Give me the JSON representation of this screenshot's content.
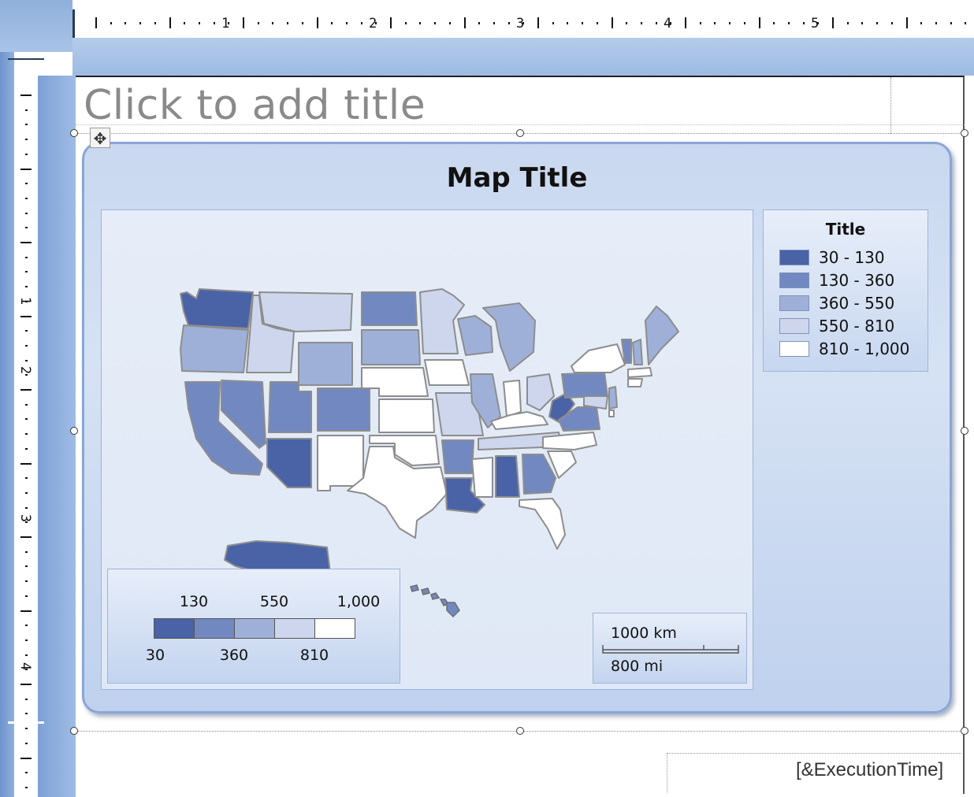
{
  "slide": {
    "title_placeholder": "Click to add title"
  },
  "ruler": {
    "horizontal_labels": [
      "1",
      "2",
      "3",
      "4",
      "5"
    ],
    "vertical_labels": [
      "1",
      "2",
      "3",
      "4"
    ]
  },
  "map": {
    "title": "Map Title",
    "legend": {
      "title": "Title",
      "items": [
        {
          "label": "30 - 130",
          "color": "#4a62a6"
        },
        {
          "label": "130 - 360",
          "color": "#7288c0"
        },
        {
          "label": "360 - 550",
          "color": "#9fb0d8"
        },
        {
          "label": "550 - 810",
          "color": "#cdd6ec"
        },
        {
          "label": "810 - 1,000",
          "color": "#ffffff"
        }
      ]
    },
    "color_scale": {
      "top_labels": [
        "130",
        "550",
        "1,000"
      ],
      "bottom_labels": [
        "30",
        "360",
        "810"
      ],
      "colors": [
        "#4a62a6",
        "#7288c0",
        "#9fb0d8",
        "#cdd6ec",
        "#ffffff"
      ]
    },
    "distance_scale": {
      "km_label": "1000 km",
      "mi_label": "800 mi"
    }
  },
  "footer": {
    "execution_time": "[&ExecutionTime]"
  }
}
